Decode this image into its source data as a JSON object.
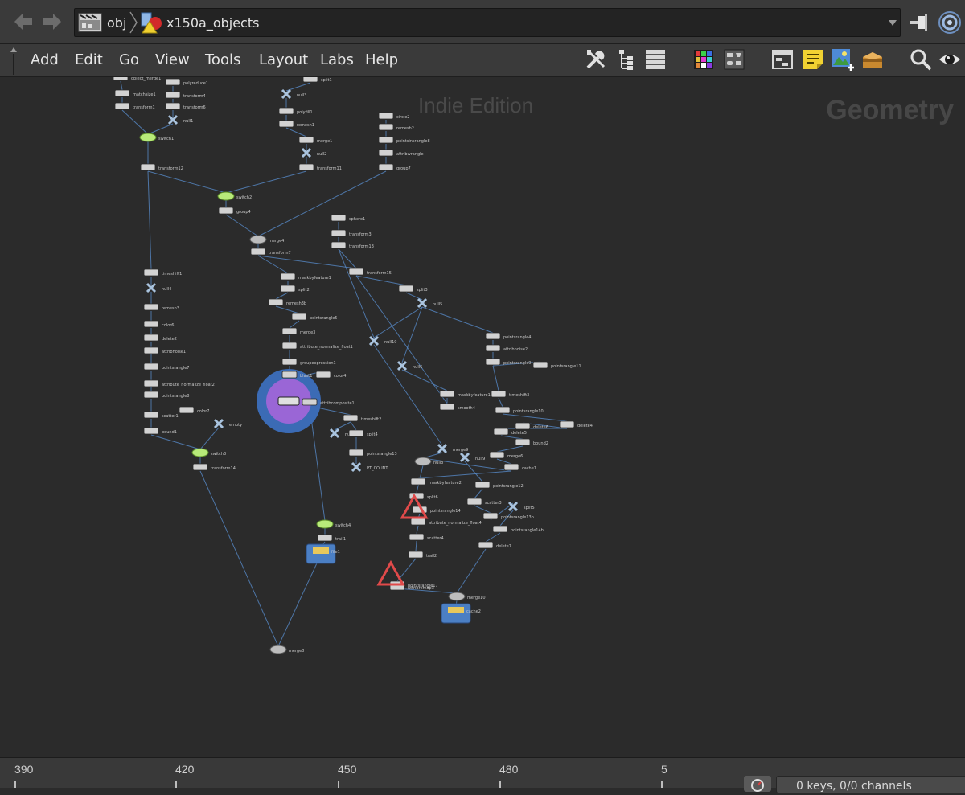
{
  "pathbar": {
    "back_icon": "left-arrow-icon",
    "forward_icon": "right-arrow-icon",
    "crumbs": [
      {
        "label": "obj",
        "icon": "obj-network-icon"
      },
      {
        "label": "x150a_objects",
        "icon": "geometry-object-icon"
      }
    ],
    "pin_icon": "pin-icon",
    "link_icon": "network-link-icon"
  },
  "menu": {
    "items": [
      "Add",
      "Edit",
      "Go",
      "View",
      "Tools",
      "Layout",
      "Labs",
      "Help"
    ],
    "tools": [
      "tools-icon",
      "tree-view-icon",
      "list-view-icon",
      "color-palette-icon",
      "shape-palette-icon",
      "network-box-icon",
      "sticky-note-icon",
      "add-image-icon",
      "subnet-icon",
      "find-icon",
      "visibility-icon"
    ]
  },
  "canvas": {
    "edition": "Indie Edition",
    "context": "Geometry",
    "accent": "#5a8fd0",
    "selection_ring": "#3b6bb5",
    "selection_fill": "#9a66d6"
  },
  "nodes": [
    "object_merge1",
    "polyreduce1",
    "matchsize1",
    "transform4",
    "transform1",
    "transform6",
    "null1",
    "switch1",
    "transform12",
    "split1",
    "null3",
    "polyfill1",
    "remesh1",
    "merge1",
    "null2",
    "transform11",
    "circle2",
    "remesh2",
    "pointsinsrangle8",
    "attribwrangle",
    "group7",
    "switch2",
    "group4",
    "merge4",
    "transform7",
    "sphere1",
    "transform3",
    "transform13",
    "transform15",
    "timeshift1",
    "null4",
    "remesh3",
    "color6",
    "delete2",
    "attribnoise1",
    "pointsrangle7",
    "attribute_normalize_float2",
    "pointsrangle8",
    "scatter1",
    "color7",
    "bound1",
    "empty",
    "switch3",
    "transform14",
    "maskbyfeature1",
    "split2",
    "remesh3b",
    "pointsrangle5",
    "merge3",
    "attribute_normalize_float1",
    "groupexpression1",
    "blast1",
    "color4",
    "attribcomposite1",
    "timeshift2",
    "null7",
    "split4",
    "pointsrangle13",
    "PT_COUNT",
    "split3",
    "null5",
    "null10",
    "null6",
    "maskbyfeature1b",
    "smooth4",
    "merge9",
    "null8",
    "null9",
    "pointsrangle4",
    "attribnoise2",
    "pointsrangle9",
    "pointsrangle11",
    "timeshift3",
    "pointsrangle10",
    "delete4",
    "delete6",
    "delete5",
    "bound2",
    "merge6",
    "cache1",
    "maskbyfeature2",
    "split6",
    "pointsrangle14",
    "attribute_normalize_float4",
    "scatter4",
    "trail2",
    "pointsrangle17",
    "attribremap3",
    "pointsrangle12",
    "scatter3",
    "pointsrangle13b",
    "split5",
    "pointsrangle14b",
    "delete7",
    "switch4",
    "trail1",
    "file1",
    "merge10",
    "cache2",
    "merge8"
  ],
  "timeline": {
    "ticks": [
      "390",
      "420",
      "450",
      "480",
      "5"
    ],
    "keys_label": "0 keys, 0/0 channels",
    "realtime_icon": "realtime-toggle-icon"
  }
}
